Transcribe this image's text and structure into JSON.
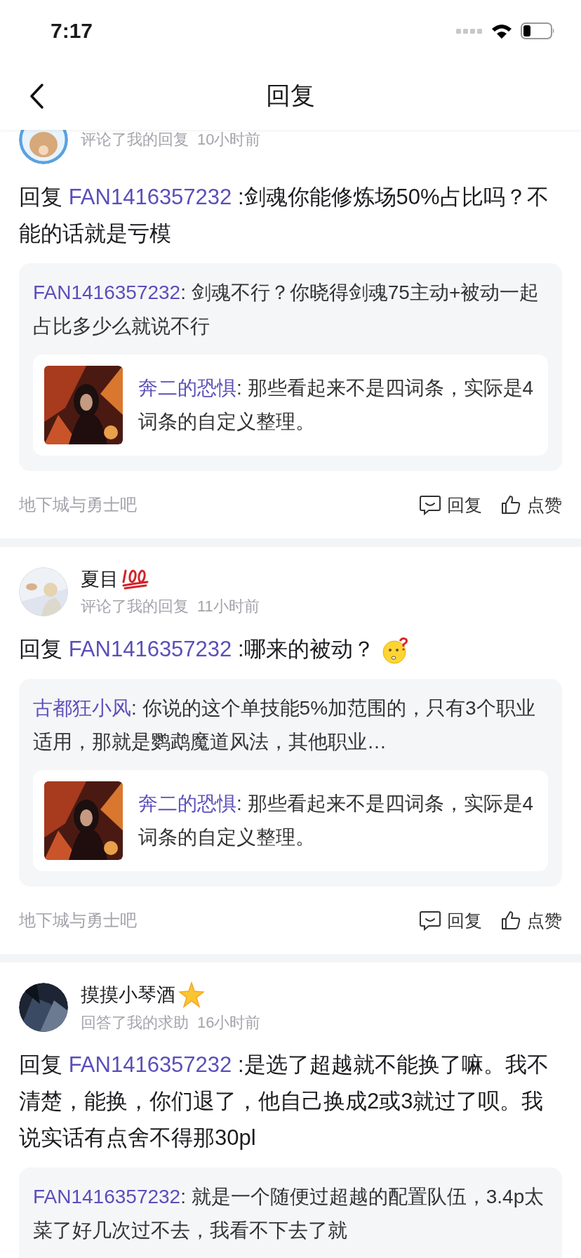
{
  "status_bar": {
    "time": "7:17"
  },
  "nav": {
    "title": "回复"
  },
  "items": [
    {
      "meta": "评论了我的回复",
      "time": "10小时前",
      "body": {
        "prefix": "回复",
        "mention": "FAN1416357232",
        "text": ":剑魂你能修炼场50%占比吗？不能的话就是亏模"
      },
      "quote": {
        "author": "FAN1416357232",
        "text": ": 剑魂不行？你晓得剑魂75主动+被动一起占比多少么就说不行",
        "inner": {
          "author": "奔二的恐惧",
          "text": ": 那些看起来不是四词条，实际是4词条的自定义整理。"
        }
      },
      "forum": "地下城与勇士吧",
      "actions": [
        "回复",
        "点赞"
      ]
    },
    {
      "name": "夏目",
      "meta": "评论了我的回复",
      "time": "11小时前",
      "body": {
        "prefix": "回复",
        "mention": "FAN1416357232",
        "text": ":哪来的被动？"
      },
      "quote": {
        "author": "古都狂小风",
        "text": ": 你说的这个单技能5%加范围的，只有3个职业适用，那就是鹦鹉魔道风法，其他职业…",
        "inner": {
          "author": "奔二的恐惧",
          "text": ": 那些看起来不是四词条，实际是4词条的自定义整理。"
        }
      },
      "forum": "地下城与勇士吧",
      "actions": [
        "回复",
        "点赞"
      ]
    },
    {
      "name": "摸摸小琴酒",
      "meta": "回答了我的求助",
      "time": "16小时前",
      "body": {
        "prefix": "回复",
        "mention": "FAN1416357232",
        "text": ":是选了超越就不能换了嘛。我不清楚，能换，你们退了，他自己换成2或3就过了呗。我说实话有点舍不得那30pl"
      },
      "quote": {
        "author": "FAN1416357232",
        "text": ": 就是一个随便过超越的配置队伍，3.4p太菜了好几次过不去，我看不下去了就"
      }
    }
  ]
}
